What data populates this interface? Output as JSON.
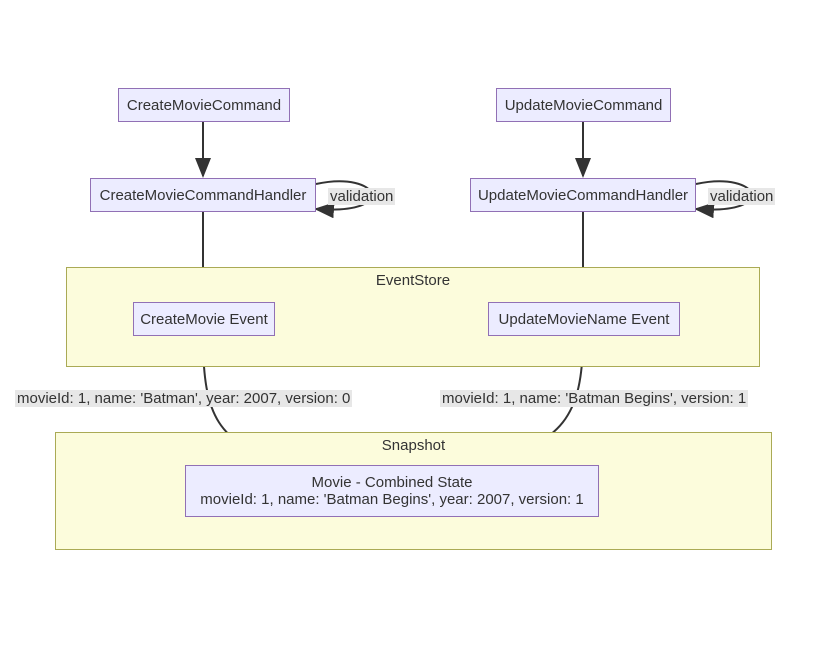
{
  "nodes": {
    "createMovieCommand": "CreateMovieCommand",
    "createMovieCommandHandler": "CreateMovieCommandHandler",
    "updateMovieCommand": "UpdateMovieCommand",
    "updateMovieCommandHandler": "UpdateMovieCommandHandler",
    "createMovieEvent": "CreateMovie Event",
    "updateMovieNameEvent": "UpdateMovieName Event",
    "combinedStateLine1": "Movie - Combined State",
    "combinedStateLine2": "movieId: 1, name: 'Batman Begins', year: 2007, version: 1"
  },
  "subgraphs": {
    "eventStore": "EventStore",
    "snapshot": "Snapshot"
  },
  "edgeLabels": {
    "validation1": "validation",
    "validation2": "validation",
    "event1Desc": "movieId: 1, name: 'Batman', year: 2007, version: 0",
    "event2Desc": "movieId: 1, name: 'Batman Begins', version: 1"
  }
}
